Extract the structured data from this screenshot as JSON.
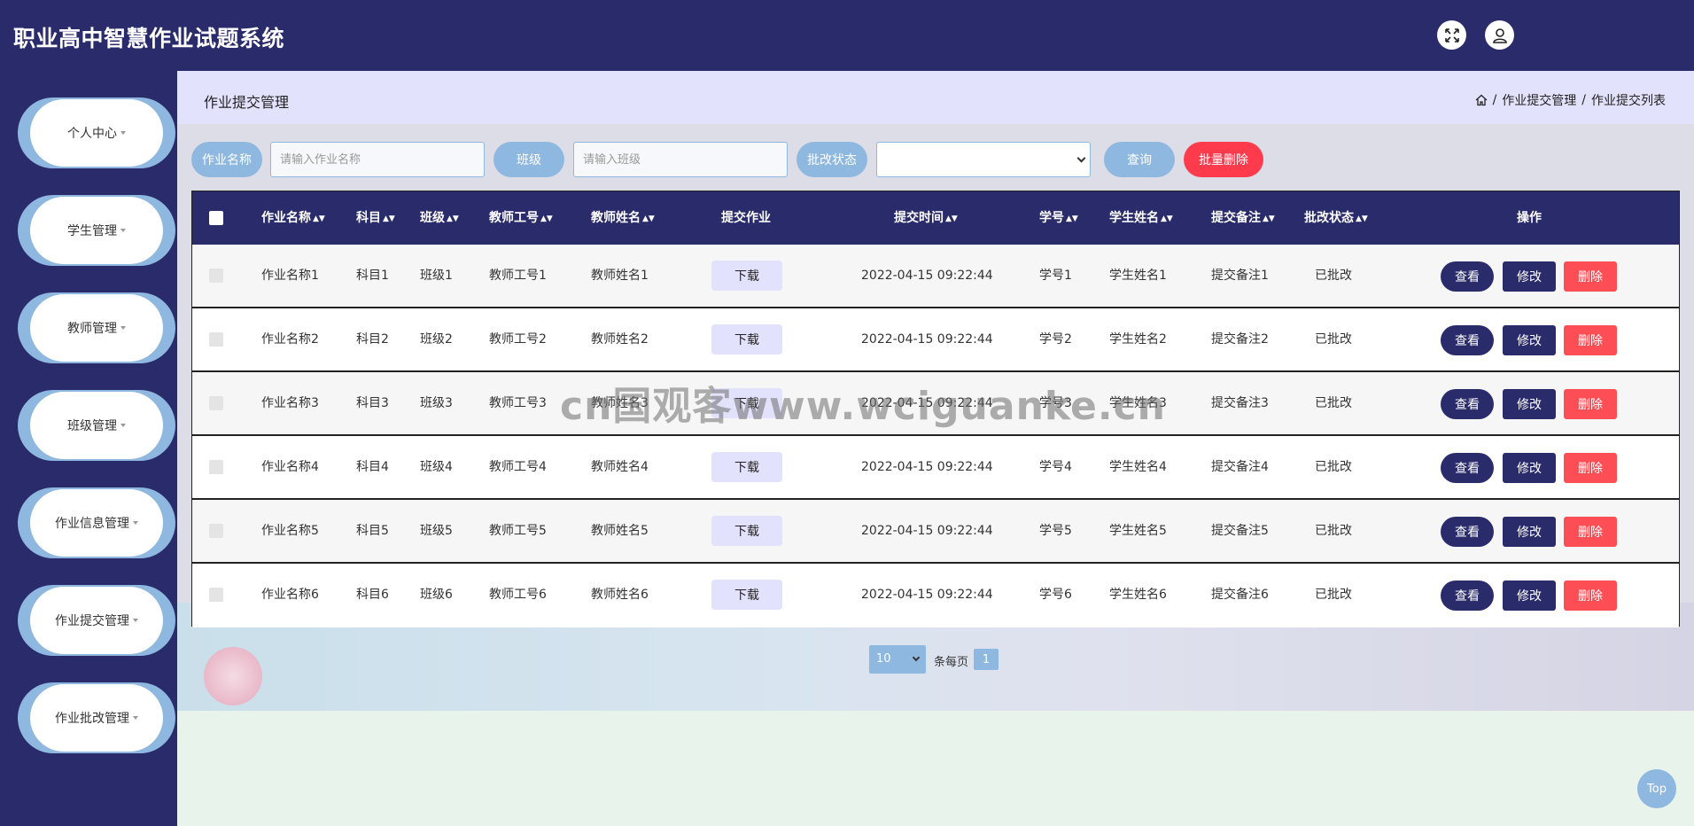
{
  "app": {
    "title": "职业高中智慧作业试题系统"
  },
  "header": {
    "expand_icon": "fullscreen-icon",
    "user_icon": "user-icon"
  },
  "sidebar": {
    "items": [
      {
        "label": "个人中心"
      },
      {
        "label": "学生管理"
      },
      {
        "label": "教师管理"
      },
      {
        "label": "班级管理"
      },
      {
        "label": "作业信息管理"
      },
      {
        "label": "作业提交管理"
      },
      {
        "label": "作业批改管理"
      }
    ]
  },
  "page": {
    "title": "作业提交管理",
    "breadcrumb": [
      "作业提交管理",
      "作业提交列表"
    ],
    "breadcrumb_sep": "/"
  },
  "search": {
    "name_label": "作业名称",
    "name_placeholder": "请输入作业名称",
    "class_label": "班级",
    "class_placeholder": "请输入班级",
    "status_label": "批改状态",
    "status_value": "",
    "query_button": "查询",
    "batch_delete_button": "批量删除"
  },
  "table": {
    "columns": [
      "作业名称",
      "科目",
      "班级",
      "教师工号",
      "教师姓名",
      "提交作业",
      "提交时间",
      "学号",
      "学生姓名",
      "提交备注",
      "批改状态",
      "操作"
    ],
    "download_label": "下载",
    "actions": {
      "view": "查看",
      "edit": "修改",
      "delete": "删除"
    },
    "rows": [
      {
        "name": "作业名称1",
        "subject": "科目1",
        "class": "班级1",
        "teacher_no": "教师工号1",
        "teacher_name": "教师姓名1",
        "time": "2022-04-15 09:22:44",
        "student_no": "学号1",
        "student_name": "学生姓名1",
        "remark": "提交备注1",
        "status": "已批改"
      },
      {
        "name": "作业名称2",
        "subject": "科目2",
        "class": "班级2",
        "teacher_no": "教师工号2",
        "teacher_name": "教师姓名2",
        "time": "2022-04-15 09:22:44",
        "student_no": "学号2",
        "student_name": "学生姓名2",
        "remark": "提交备注2",
        "status": "已批改"
      },
      {
        "name": "作业名称3",
        "subject": "科目3",
        "class": "班级3",
        "teacher_no": "教师工号3",
        "teacher_name": "教师姓名3",
        "time": "2022-04-15 09:22:44",
        "student_no": "学号3",
        "student_name": "学生姓名3",
        "remark": "提交备注3",
        "status": "已批改"
      },
      {
        "name": "作业名称4",
        "subject": "科目4",
        "class": "班级4",
        "teacher_no": "教师工号4",
        "teacher_name": "教师姓名4",
        "time": "2022-04-15 09:22:44",
        "student_no": "学号4",
        "student_name": "学生姓名4",
        "remark": "提交备注4",
        "status": "已批改"
      },
      {
        "name": "作业名称5",
        "subject": "科目5",
        "class": "班级5",
        "teacher_no": "教师工号5",
        "teacher_name": "教师姓名5",
        "time": "2022-04-15 09:22:44",
        "student_no": "学号5",
        "student_name": "学生姓名5",
        "remark": "提交备注5",
        "status": "已批改"
      },
      {
        "name": "作业名称6",
        "subject": "科目6",
        "class": "班级6",
        "teacher_no": "教师工号6",
        "teacher_name": "教师姓名6",
        "time": "2022-04-15 09:22:44",
        "student_no": "学号6",
        "student_name": "学生姓名6",
        "remark": "提交备注6",
        "status": "已批改"
      }
    ]
  },
  "pagination": {
    "page_size": "10",
    "per_page_label": "条每页",
    "current_page": "1"
  },
  "misc": {
    "top_button": "Top",
    "watermark": "cn国观客www.wciguanke.cn"
  },
  "colors": {
    "primary": "#2a2b6b",
    "accent": "#8fb8e0",
    "danger": "#fe3a4d",
    "title_bar": "#e3e2fd"
  }
}
